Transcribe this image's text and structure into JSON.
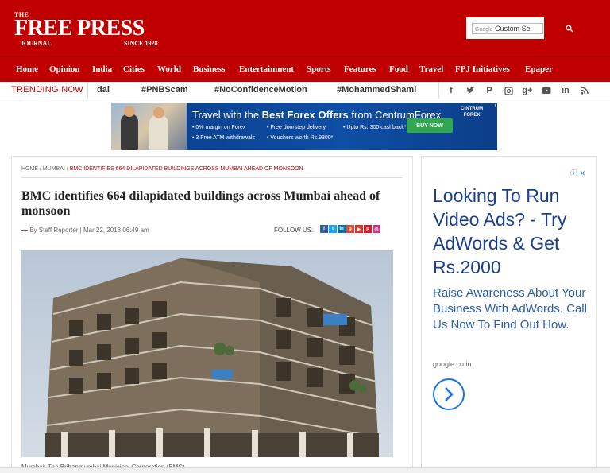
{
  "header": {
    "logo_the": "THE",
    "logo_main": "FREE PRESS",
    "logo_journal": "JOURNAL",
    "logo_since": "SINCE 1928",
    "search_google": "Google",
    "search_placeholder": "Custom Se"
  },
  "nav": {
    "items": [
      "Home",
      "Opinion",
      "India",
      "Cities",
      "World",
      "Business",
      "Entertainment",
      "Sports",
      "Features",
      "Food",
      "Travel",
      "FPJ Initiatives",
      "Epaper"
    ]
  },
  "trending": {
    "label": "TRENDING NOW",
    "items": [
      "dal",
      "#PNBScam",
      "#NoConfidenceMotion",
      "#MohammedShami"
    ]
  },
  "social": {
    "icons": [
      "f",
      "t",
      "p",
      "ig",
      "g+",
      "yt",
      "in",
      "rss"
    ]
  },
  "banner": {
    "title_pre": "Travel with the ",
    "title_bold": "Best Forex Offers",
    "title_post": " from CentrumForex",
    "points": [
      "• 0% margin on Forex",
      "• Free doorstep delivery",
      "• Upto Rs. 300 cashback*",
      "• 3 Free ATM withdrawals",
      "• Vouchers worth Rs.9300*"
    ],
    "buy_label": "BUY NOW",
    "brand_line1": "C•NTRUM",
    "brand_line2": "FOREX"
  },
  "article": {
    "breadcrumb_home": "HOME",
    "breadcrumb_section": "MUMBAI",
    "breadcrumb_current": "BMC IDENTIFIES 664 DILAPIDATED BUILDINGS ACROSS MUMBAI AHEAD OF MONSOON",
    "headline": "BMC identifies 664 dilapidated buildings across Mumbai ahead of monsoon",
    "byline_author": "By Staff Reporter",
    "byline_date": "Mar 22, 2018 06:49 am",
    "follow_label": "FOLLOW US:",
    "text_start": "Mumbai: The Brihanmumbai Municipal Corporation (BMC) ..."
  },
  "side_ad": {
    "headline": "Looking To Run Video Ads? - Try AdWords & Get Rs.2000",
    "sub": "Raise Awareness About Your Business With AdWords. Call Us Now To Find Out How.",
    "domain": "google.co.in"
  },
  "colors": {
    "brand_red": "#c00000",
    "ad_blue": "#1a3e8c"
  }
}
